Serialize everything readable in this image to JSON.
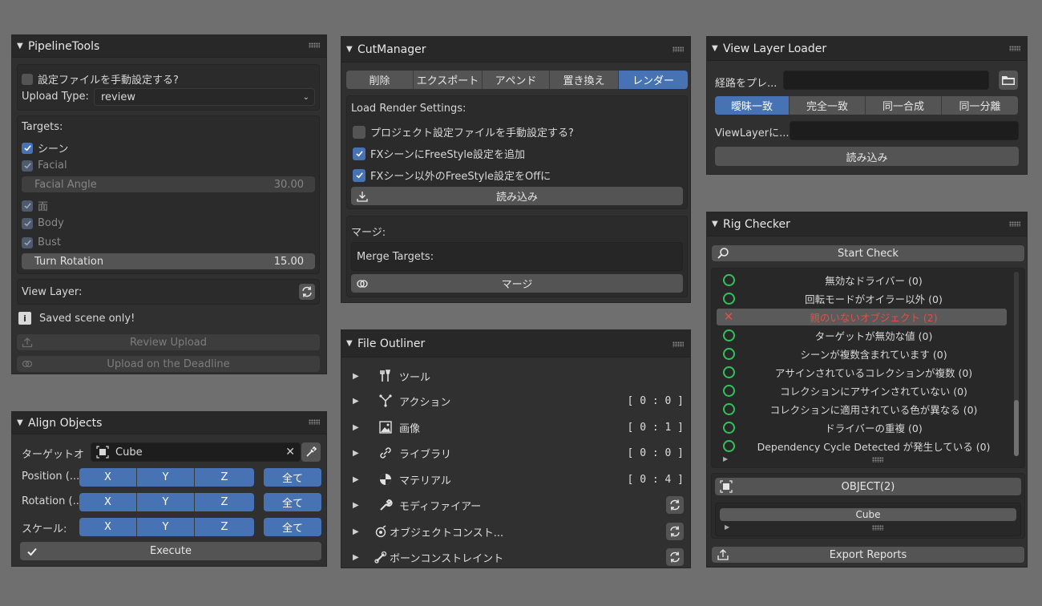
{
  "pipeline": {
    "title": "PipelineTools",
    "manual_config": "設定ファイルを手動設定する?",
    "upload_type_label": "Upload Type:",
    "upload_type_value": "review",
    "targets_label": "Targets:",
    "t_scene": "シーン",
    "t_facial": "Facial",
    "facial_angle_label": "Facial Angle",
    "facial_angle_value": "30.00",
    "t_face": "面",
    "t_body": "Body",
    "t_bust": "Bust",
    "turn_rotation_label": "Turn Rotation",
    "turn_rotation_value": "15.00",
    "view_layer_label": "View Layer:",
    "info_text": "Saved scene only!",
    "review_upload": "Review Upload",
    "upload_deadline": "Upload on the Deadline"
  },
  "align": {
    "title": "Align Objects",
    "target_label": "ターゲットオ",
    "target_value": "Cube",
    "position_label": "Position (...",
    "rotation_label": "Rotation (...",
    "scale_label": "スケール:",
    "x": "X",
    "y": "Y",
    "z": "Z",
    "all": "全て",
    "execute": "Execute"
  },
  "cut": {
    "title": "CutManager",
    "tabs": [
      "削除",
      "エクスポート",
      "アペンド",
      "置き換え",
      "レンダー"
    ],
    "load_render_label": "Load Render Settings:",
    "opt1": "プロジェクト設定ファイルを手動設定する?",
    "opt2": "FXシーンにFreeStyle設定を追加",
    "opt3": "FXシーン以外のFreeStyle設定をOffに",
    "load_button": "読み込み",
    "merge_label": "マージ:",
    "merge_targets": "Merge Targets:",
    "merge_button": "マージ"
  },
  "outliner": {
    "title": "File Outliner",
    "rows": [
      {
        "label": "ツール",
        "count": ""
      },
      {
        "label": "アクション",
        "count": "[ 0 : 0 ]"
      },
      {
        "label": "画像",
        "count": "[ 0 : 1 ]"
      },
      {
        "label": "ライブラリ",
        "count": "[ 0 : 0 ]"
      },
      {
        "label": "マテリアル",
        "count": "[ 0 : 4 ]"
      },
      {
        "label": "モディファイアー",
        "count": ""
      },
      {
        "label": "オブジェクトコンスト...",
        "count": ""
      },
      {
        "label": "ボーンコンストレイント",
        "count": ""
      }
    ]
  },
  "viewlayer": {
    "title": "View Layer Loader",
    "path_label": "経路をプレ...",
    "modes": [
      "曖昧一致",
      "完全一致",
      "同一合成",
      "同一分離"
    ],
    "viewlayer_label": "ViewLayerに...",
    "load_button": "読み込み"
  },
  "rig": {
    "title": "Rig Checker",
    "start_check": "Start Check",
    "items": [
      {
        "text": "無効なドライバー (0)",
        "status": "ok"
      },
      {
        "text": "回転モードがオイラー以外 (0)",
        "status": "ok"
      },
      {
        "text": "親のいないオブジェクト (2)",
        "status": "error"
      },
      {
        "text": "ターゲットが無効な値 (0)",
        "status": "ok"
      },
      {
        "text": "シーンが複数含まれています (0)",
        "status": "ok"
      },
      {
        "text": "アサインされているコレクションが複数 (0)",
        "status": "ok"
      },
      {
        "text": "コレクションにアサインされていない (0)",
        "status": "ok"
      },
      {
        "text": "コレクションに適用されている色が異なる (0)",
        "status": "ok"
      },
      {
        "text": "ドライバーの重複 (0)",
        "status": "ok"
      },
      {
        "text": "Dependency Cycle Detected が発生している (0)",
        "status": "ok"
      }
    ],
    "object_header": "OBJECT(2)",
    "object_item": "Cube",
    "export_reports": "Export Reports"
  },
  "colors": {
    "accent": "#4772b3",
    "ok": "#33c25a",
    "error": "#e0504a"
  }
}
